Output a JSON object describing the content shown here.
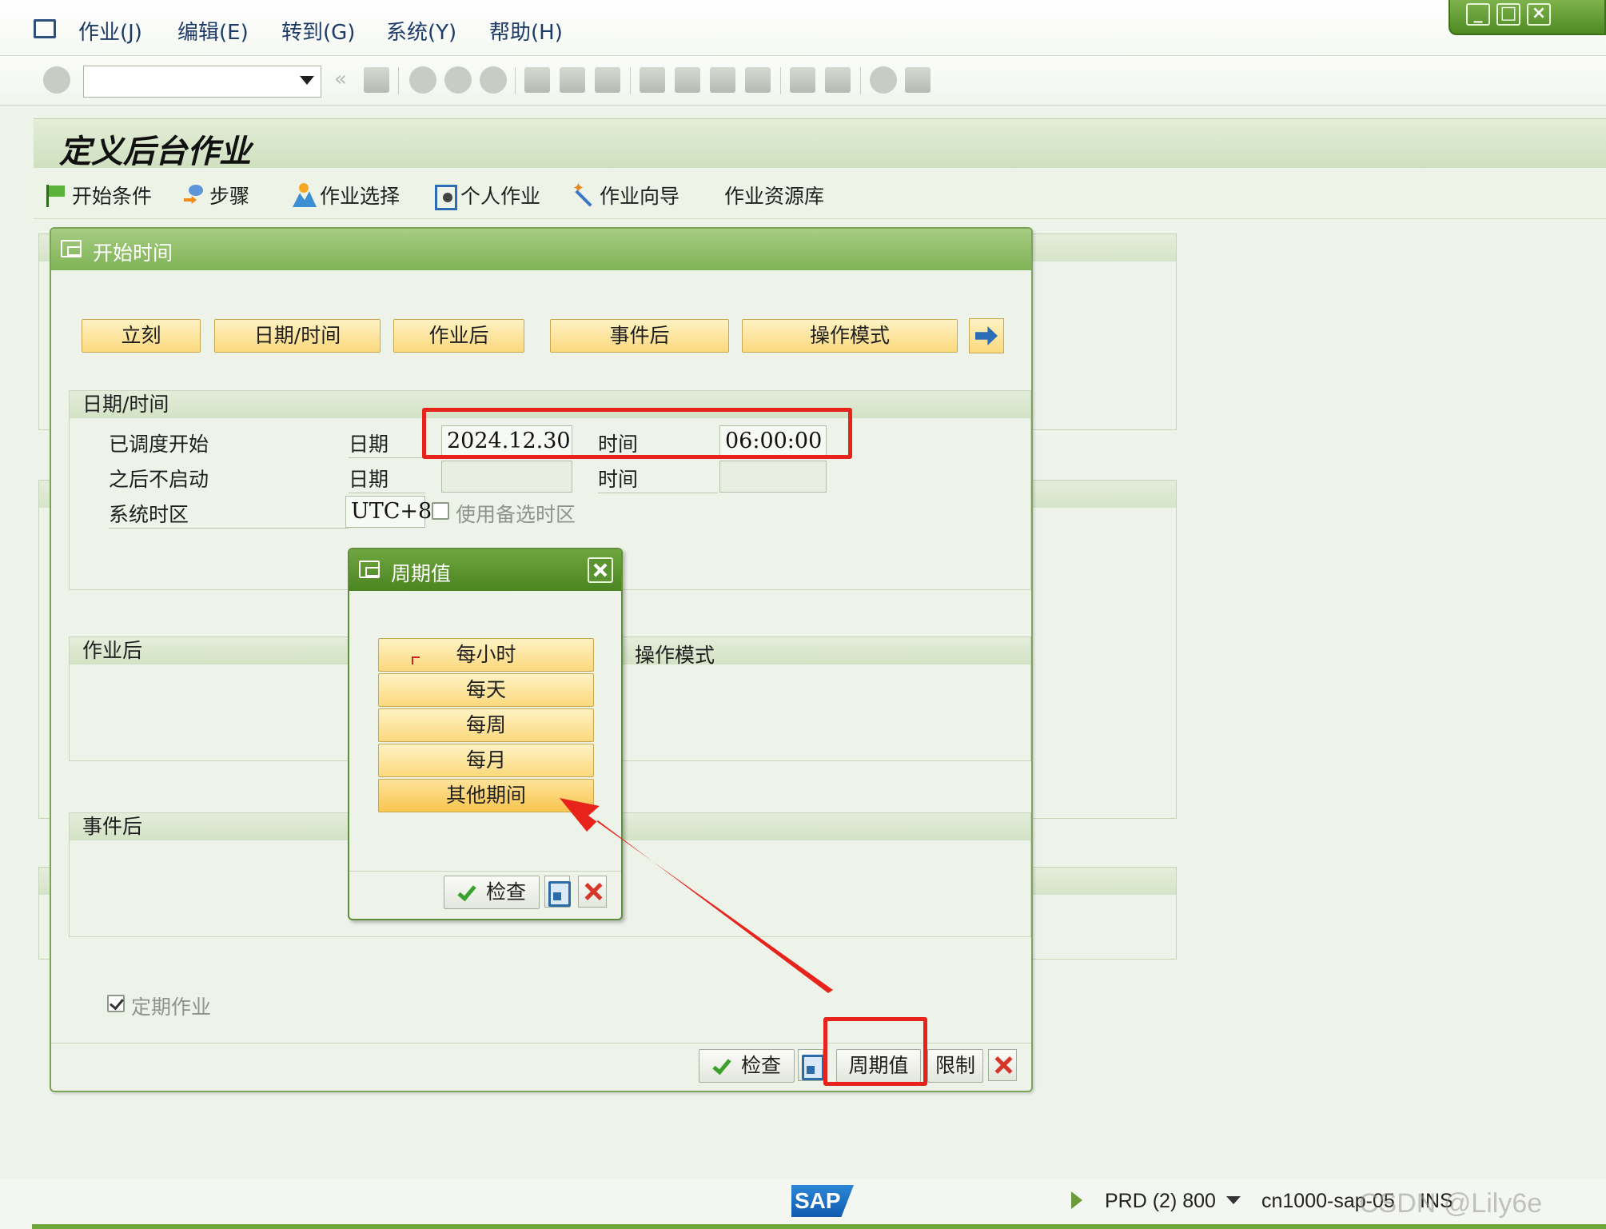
{
  "menu": {
    "items": [
      "作业(J)",
      "编辑(E)",
      "转到(G)",
      "系统(Y)",
      "帮助(H)"
    ]
  },
  "window_controls": [
    "minimize-icon",
    "maximize-icon",
    "close-icon"
  ],
  "toolbar": {
    "command_value": "",
    "icons": [
      "enter-icon",
      "save-icon",
      "back-icon",
      "exit-icon",
      "cancel-icon",
      "print-icon",
      "find-icon",
      "find-next-icon",
      "first-page-icon",
      "previous-page-icon",
      "next-page-icon",
      "last-page-icon",
      "new-session-icon",
      "shortcut-icon",
      "help-icon",
      "customize-layout-icon"
    ]
  },
  "page": {
    "title": "定义后台作业"
  },
  "app_toolbar": {
    "start_condition": "开始条件",
    "steps": "步骤",
    "job_selection": "作业选择",
    "own_jobs": "个人作业",
    "job_wizard": "作业向导",
    "job_repository": "作业资源库"
  },
  "start_dialog": {
    "title": "开始时间",
    "buttons": {
      "immediate": "立刻",
      "date_time": "日期/时间",
      "after_job": "作业后",
      "after_event": "事件后",
      "operation_mode": "操作模式"
    },
    "datetime_group": {
      "title": "日期/时间",
      "scheduled_start_label": "已调度开始",
      "date_label": "日期",
      "time_label": "时间",
      "start_date": "2024.12.30",
      "start_time": "06:00:00",
      "no_start_after_label": "之后不启动",
      "no_start_after_date": "",
      "no_start_after_time": "",
      "timezone_label": "系统时区",
      "timezone": "UTC+8",
      "alt_timezone_label": "使用备选时区",
      "alt_timezone_checked": false
    },
    "after_job_group": {
      "title": "作业后"
    },
    "operation_mode_group": {
      "title": "操作模式"
    },
    "after_event_group": {
      "title": "事件后"
    },
    "periodic_job_label": "定期作业",
    "periodic_job_checked": true,
    "footer": {
      "check": "检查",
      "period_values": "周期值",
      "restrictions": "限制"
    }
  },
  "period_dialog": {
    "title": "周期值",
    "options": [
      "每小时",
      "每天",
      "每周",
      "每月",
      "其他期间"
    ],
    "footer": {
      "check": "检查"
    }
  },
  "status_bar": {
    "system": "PRD (2) 800",
    "server": "cn1000-sap-05",
    "mode": "INS",
    "watermark": "CSDN @Lily6e"
  },
  "colors": {
    "sap_green": "#7fb256",
    "button_yellow": "#fbd97d",
    "annotation_red": "#e8231b"
  }
}
